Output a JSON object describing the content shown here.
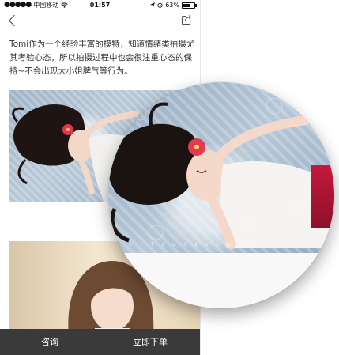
{
  "status_bar": {
    "signal_dots": "●●●●●",
    "carrier": "中国移动",
    "time": "01:57",
    "battery_percent": "63%",
    "battery_level": 0.63
  },
  "nav": {
    "back_icon": "chevron-left-icon",
    "share_icon": "share-icon"
  },
  "content": {
    "description": "Tomi作为一个经验丰富的模特，知道情绪类拍摄尤其考验心态，所以拍摄过程中也会很注重心态的保持~不会出现大小姐脾气等行为。",
    "watermark": "o t l i v i s n p g u n"
  },
  "bottom_bar": {
    "consult_label": "咨询",
    "order_label": "立即下单"
  }
}
